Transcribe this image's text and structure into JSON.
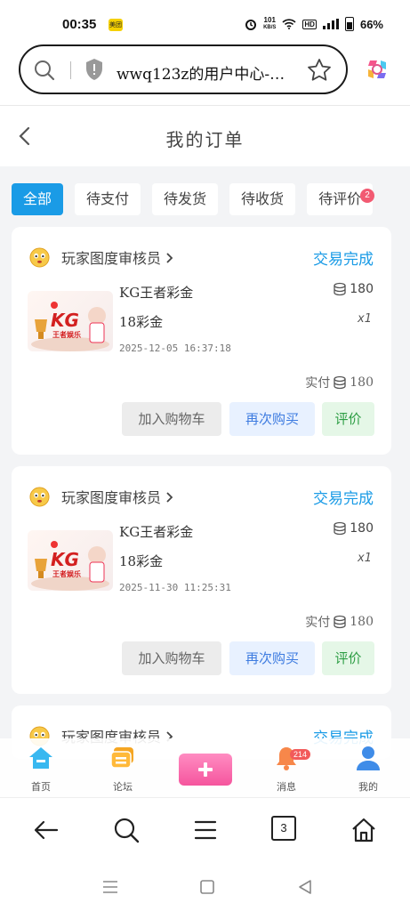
{
  "status_bar": {
    "time": "00:35",
    "app_badge": "美团",
    "speed_value": "101",
    "speed_unit": "KB/S",
    "hd": "HD",
    "battery": "66%"
  },
  "browser": {
    "url_text": "wwq123z的用户中心-…"
  },
  "page": {
    "title": "我的订单"
  },
  "tabs": [
    {
      "label": "全部",
      "active": true
    },
    {
      "label": "待支付"
    },
    {
      "label": "待发货"
    },
    {
      "label": "待收货"
    },
    {
      "label": "待评价",
      "badge": "2"
    }
  ],
  "orders": [
    {
      "seller": "玩家图度审核员",
      "status": "交易完成",
      "product_name": "KG王者彩金",
      "spec": "18彩金",
      "date": "2025-12-05 16:37:18",
      "price": "180",
      "qty": "x1",
      "paid_label": "实付",
      "paid": "180",
      "thumb_logo": "KG",
      "thumb_sub": "王者娱乐",
      "btn_cart": "加入购物车",
      "btn_rebuy": "再次购买",
      "btn_review": "评价"
    },
    {
      "seller": "玩家图度审核员",
      "status": "交易完成",
      "product_name": "KG王者彩金",
      "spec": "18彩金",
      "date": "2025-11-30 11:25:31",
      "price": "180",
      "qty": "x1",
      "paid_label": "实付",
      "paid": "180",
      "thumb_logo": "KG",
      "thumb_sub": "王者娱乐",
      "btn_cart": "加入购物车",
      "btn_rebuy": "再次购买",
      "btn_review": "评价"
    },
    {
      "seller": "玩家图度审核员",
      "status": "交易完成"
    }
  ],
  "bottom_nav": {
    "home": "首页",
    "forum": "论坛",
    "messages": "消息",
    "messages_badge": "214",
    "mine": "我的"
  },
  "browser_nav": {
    "tab_count": "3"
  }
}
